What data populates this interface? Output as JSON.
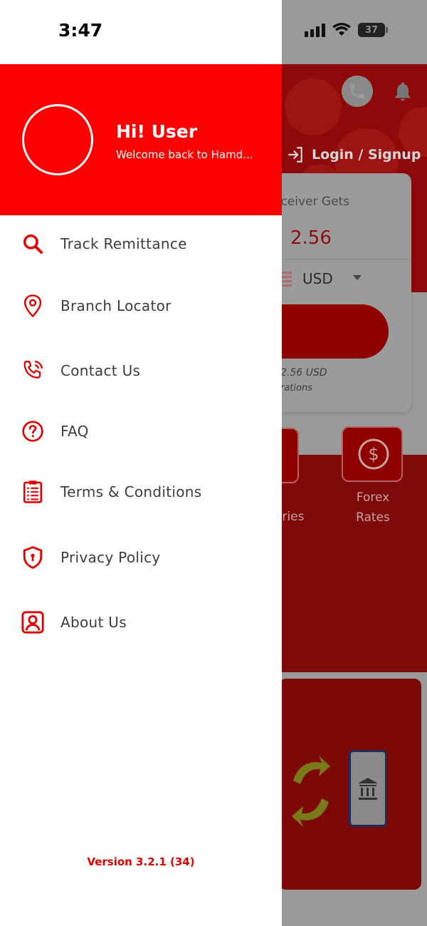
{
  "status_bar": {
    "time": "3:47",
    "battery": "37"
  },
  "drawer": {
    "greeting": "Hi! User",
    "welcome": "Welcome back to Hamd...",
    "menu": [
      {
        "label": "Track Remittance",
        "icon": "search-icon"
      },
      {
        "label": "Branch Locator",
        "icon": "location-pin-icon"
      },
      {
        "label": "Contact Us",
        "icon": "phone-call-icon"
      },
      {
        "label": "FAQ",
        "icon": "question-icon"
      },
      {
        "label": "Terms & Conditions",
        "icon": "clipboard-icon"
      },
      {
        "label": "Privacy Policy",
        "icon": "shield-icon"
      },
      {
        "label": "About Us",
        "icon": "user-icon"
      }
    ],
    "version": "Version 3.2.1 (34)"
  },
  "background": {
    "login_label": "Login / Signup",
    "receiver_label": "eceiver Gets",
    "receiver_amount": "2.56",
    "currency": "USD",
    "rate_line": "2.56 USD",
    "rate_note": "rations",
    "tile_beneficiaries_label": "aries",
    "tile_forex_label_1": "Forex",
    "tile_forex_label_2": "Rates"
  },
  "colors": {
    "brand_red": "#ff0000",
    "text_gray": "#3d3d3d",
    "version_red": "#e00000"
  }
}
